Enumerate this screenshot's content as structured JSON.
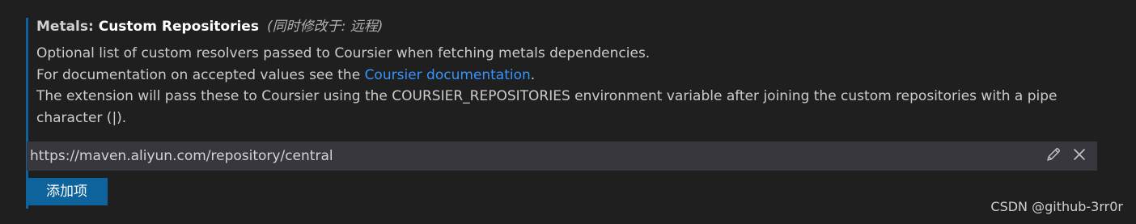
{
  "setting": {
    "category": "Metals: ",
    "label": "Custom Repositories",
    "modified_note": "(同时修改于: 远程)",
    "description": {
      "line1": "Optional list of custom resolvers passed to Coursier when fetching metals dependencies.",
      "line2_prefix": "For documentation on accepted values see the ",
      "line2_link": "Coursier documentation",
      "line2_suffix": ".",
      "line3": "The extension will pass these to Coursier using the COURSIER_REPOSITORIES environment variable after joining the custom repositories with a pipe character (|)."
    },
    "items": [
      {
        "value": "https://maven.aliyun.com/repository/central"
      }
    ],
    "add_button_label": "添加项"
  },
  "icons": {
    "edit": "pencil-icon",
    "remove": "close-icon"
  },
  "colors": {
    "accent": "#0e639c",
    "link": "#3794ff",
    "background": "#1f1f1f",
    "row_background": "#37373d"
  },
  "watermark": "CSDN @github-3rr0r"
}
